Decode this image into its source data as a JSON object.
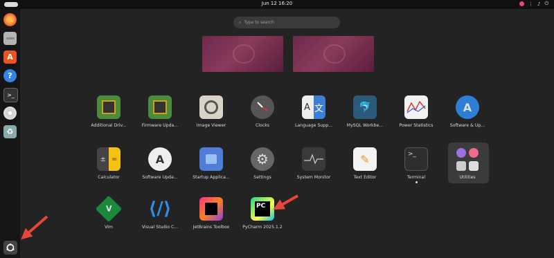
{
  "topbar": {
    "clock": "Jun 12  16:20"
  },
  "search": {
    "placeholder": "Type to search"
  },
  "apps": [
    {
      "label": "Additional Driv...",
      "icon": "chip-icon"
    },
    {
      "label": "Firmware Upda...",
      "icon": "chip-icon"
    },
    {
      "label": "Image Viewer",
      "icon": "image-viewer-icon"
    },
    {
      "label": "Clocks",
      "icon": "clock-icon"
    },
    {
      "label": "Language Supp...",
      "icon": "language-icon"
    },
    {
      "label": "MySQL Workbe...",
      "icon": "mysql-icon"
    },
    {
      "label": "Power Statistics",
      "icon": "chart-icon"
    },
    {
      "label": "Software & Up...",
      "icon": "software-updates-icon"
    },
    {
      "label": "Calculator",
      "icon": "calculator-icon"
    },
    {
      "label": "Software Upda...",
      "icon": "software-updater-icon"
    },
    {
      "label": "Startup Applica...",
      "icon": "startup-icon"
    },
    {
      "label": "Settings",
      "icon": "gear-icon"
    },
    {
      "label": "System Monitor",
      "icon": "system-monitor-icon"
    },
    {
      "label": "Text Editor",
      "icon": "text-editor-icon"
    },
    {
      "label": "Terminal",
      "icon": "terminal-icon"
    },
    {
      "label": "Utilities",
      "icon": "folder-icon"
    },
    {
      "label": "Vim",
      "icon": "vim-icon"
    },
    {
      "label": "Visual Studio C...",
      "icon": "vscode-icon"
    },
    {
      "label": "JetBrains Toolbox",
      "icon": "jetbrains-icon"
    },
    {
      "label": "PyCharm 2025.1.2",
      "icon": "pycharm-icon"
    }
  ],
  "colors": {
    "accent": "#e8467a",
    "ubuntu_purple": "#7a2c58"
  }
}
